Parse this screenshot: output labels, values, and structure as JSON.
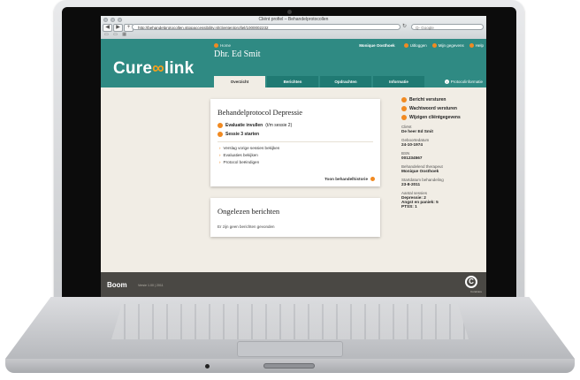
{
  "window": {
    "title": "Cliënt profiel – Behandelprotocollen"
  },
  "browser": {
    "url": "http://behandelprotocollen.stippaccessibility.nl/clienten/profiel/1000002232",
    "search_placeholder": "Q- Google",
    "back_glyph": "◀",
    "forward_glyph": "▶",
    "add_glyph": "+",
    "reload_glyph": "↻",
    "bookmark_glyphs": "▭ ▭ ▦"
  },
  "app": {
    "logo_left": "Cure",
    "logo_mid": "∞",
    "logo_right": "link",
    "home_label": "Home",
    "patient_name": "Dhr. Ed Smit",
    "user_name": "Monique Oosthoek",
    "top_links": [
      "Uitloggen",
      "Mijn gegevens",
      "Help"
    ],
    "tabs": [
      "Overzicht",
      "Berichten",
      "Opdrachten",
      "Informatie"
    ],
    "active_tab": "Overzicht",
    "protocol_info": "Protocolinformatie"
  },
  "protocol_card": {
    "title": "Behandelprotocol Depressie",
    "action1_bold": "Evaluatie invullen",
    "action1_rest": "(t/m sessie 2)",
    "action2": "Sessie 3 starten",
    "links": [
      "Verslag vorige sessies bekijken",
      "Evaluaties bekijken",
      "Protocol beëindigen"
    ],
    "history_link": "Toon behandelhistorie"
  },
  "messages_card": {
    "title": "Ongelezen berichten",
    "empty": "Er zijn geen berichten gevonden"
  },
  "sidebar": {
    "actions": [
      "Bericht versturen",
      "Wachtwoord versturen",
      "Wijzigen cliëntgegevens"
    ],
    "fields": [
      {
        "label": "Cliënt",
        "value": "De heer Ed Smit"
      },
      {
        "label": "Geboortedatum",
        "value": "24-10-1974"
      },
      {
        "label": "BSN",
        "value": "001234567"
      },
      {
        "label": "Behandelend therapeut",
        "value": "Monique Oosthoek"
      },
      {
        "label": "Startdatum behandeling",
        "value": "23-8-2011"
      }
    ],
    "sessions_label": "Aantal sessies",
    "sessions": [
      "Depressie: 2",
      "Angst en paniek: 5",
      "PTSS: 1"
    ]
  },
  "footer": {
    "brand": "Boom",
    "version": "Versie 1.00 | 2011",
    "partner_mark": "C",
    "partner_name": "CuraCare"
  },
  "colors": {
    "teal": "#2f8a83",
    "orange": "#f18a21",
    "footer": "#4a4844",
    "page": "#f1ede5"
  }
}
